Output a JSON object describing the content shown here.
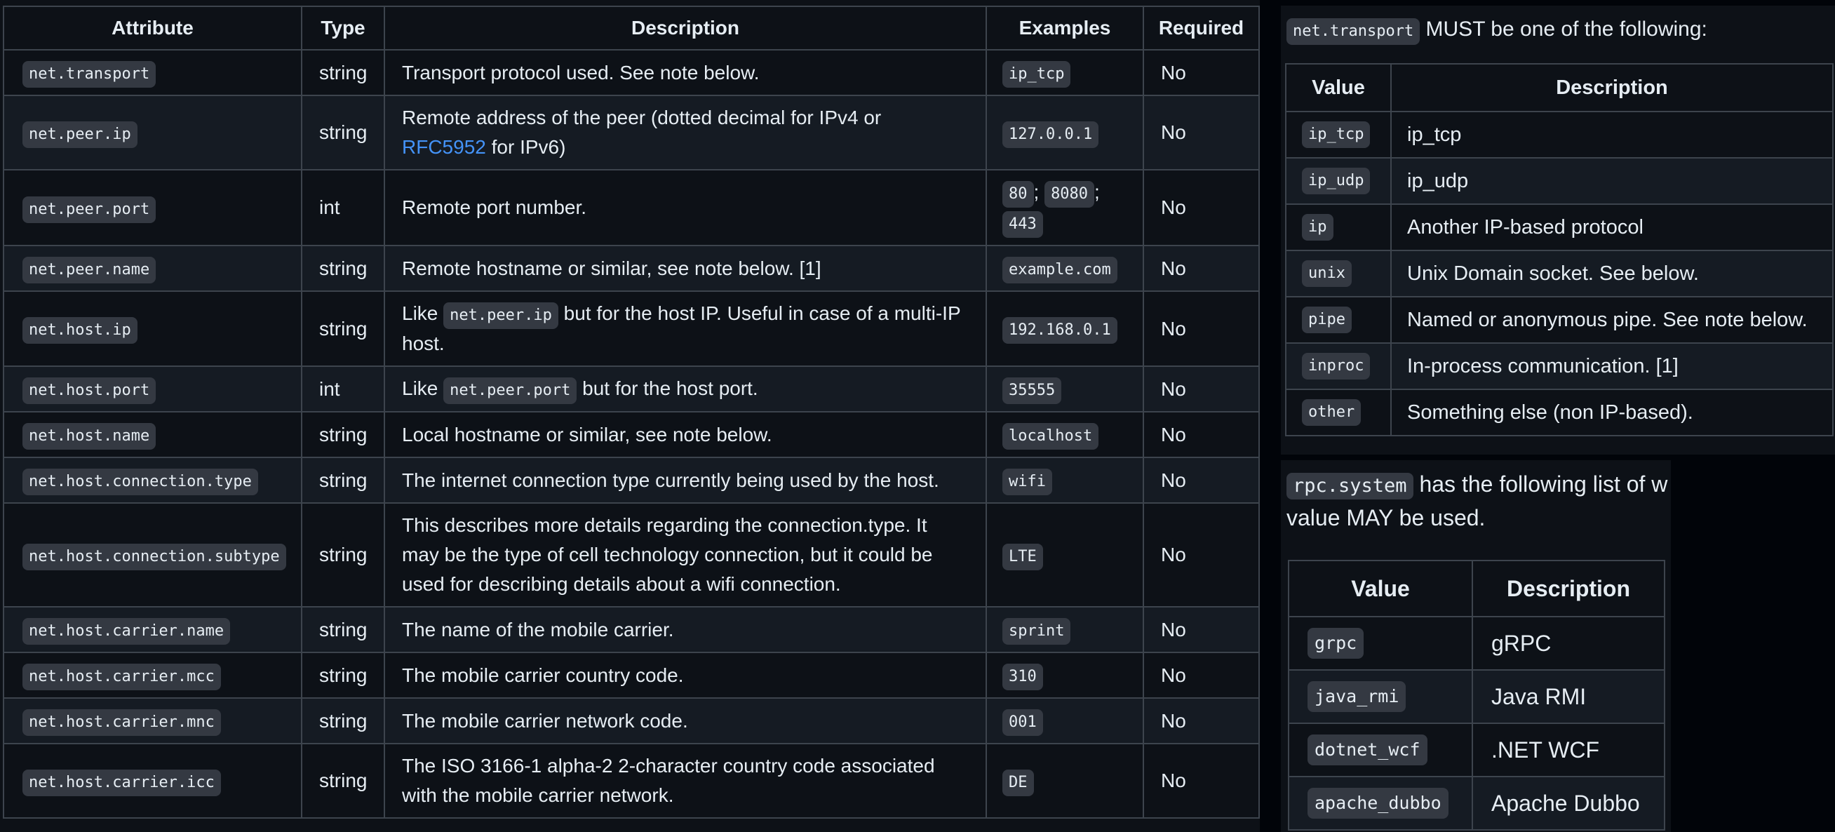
{
  "attributes_table": {
    "headers": {
      "attribute": "Attribute",
      "type": "Type",
      "description": "Description",
      "examples": "Examples",
      "required": "Required"
    },
    "rows": [
      {
        "attribute": "net.transport",
        "type": "string",
        "description": "Transport protocol used. See note below.",
        "examples": [
          "ip_tcp"
        ],
        "required": "No"
      },
      {
        "attribute": "net.peer.ip",
        "type": "string",
        "description_before": "Remote address of the peer (dotted decimal for IPv4 or ",
        "description_link": "RFC5952",
        "description_after": " for IPv6)",
        "examples": [
          "127.0.0.1"
        ],
        "required": "No"
      },
      {
        "attribute": "net.peer.port",
        "type": "int",
        "description": "Remote port number.",
        "examples": [
          "80",
          "8080",
          "443"
        ],
        "examples_separator": ";",
        "required": "No"
      },
      {
        "attribute": "net.peer.name",
        "type": "string",
        "description": "Remote hostname or similar, see note below. [1]",
        "examples": [
          "example.com"
        ],
        "required": "No"
      },
      {
        "attribute": "net.host.ip",
        "type": "string",
        "description_before": "Like ",
        "description_code": "net.peer.ip",
        "description_after": " but for the host IP. Useful in case of a multi-IP host.",
        "examples": [
          "192.168.0.1"
        ],
        "required": "No"
      },
      {
        "attribute": "net.host.port",
        "type": "int",
        "description_before": "Like ",
        "description_code": "net.peer.port",
        "description_after": " but for the host port.",
        "examples": [
          "35555"
        ],
        "required": "No"
      },
      {
        "attribute": "net.host.name",
        "type": "string",
        "description": "Local hostname or similar, see note below.",
        "examples": [
          "localhost"
        ],
        "required": "No"
      },
      {
        "attribute": "net.host.connection.type",
        "type": "string",
        "description": "The internet connection type currently being used by the host.",
        "examples": [
          "wifi"
        ],
        "required": "No"
      },
      {
        "attribute": "net.host.connection.subtype",
        "type": "string",
        "description": "This describes more details regarding the connection.type. It may be the type of cell technology connection, but it could be used for describing details about a wifi connection.",
        "examples": [
          "LTE"
        ],
        "required": "No"
      },
      {
        "attribute": "net.host.carrier.name",
        "type": "string",
        "description": "The name of the mobile carrier.",
        "examples": [
          "sprint"
        ],
        "required": "No"
      },
      {
        "attribute": "net.host.carrier.mcc",
        "type": "string",
        "description": "The mobile carrier country code.",
        "examples": [
          "310"
        ],
        "required": "No"
      },
      {
        "attribute": "net.host.carrier.mnc",
        "type": "string",
        "description": "The mobile carrier network code.",
        "examples": [
          "001"
        ],
        "required": "No"
      },
      {
        "attribute": "net.host.carrier.icc",
        "type": "string",
        "description": "The ISO 3166-1 alpha-2 2-character country code associated with the mobile carrier network.",
        "examples": [
          "DE"
        ],
        "required": "No"
      }
    ]
  },
  "transport_panel": {
    "intro_code": "net.transport",
    "intro_text": " MUST be one of the following:",
    "headers": {
      "value": "Value",
      "description": "Description"
    },
    "rows": [
      {
        "value": "ip_tcp",
        "description": "ip_tcp"
      },
      {
        "value": "ip_udp",
        "description": "ip_udp"
      },
      {
        "value": "ip",
        "description": "Another IP-based protocol"
      },
      {
        "value": "unix",
        "description": "Unix Domain socket. See below."
      },
      {
        "value": "pipe",
        "description": "Named or anonymous pipe. See note below."
      },
      {
        "value": "inproc",
        "description": "In-process communication. [1]"
      },
      {
        "value": "other",
        "description": "Something else (non IP-based)."
      }
    ]
  },
  "rpc_panel": {
    "intro_code": "rpc.system",
    "intro_text_line1": " has the following list of w",
    "intro_text_line2": "value MAY be used.",
    "headers": {
      "value": "Value",
      "description": "Description"
    },
    "rows": [
      {
        "value": "grpc",
        "description": "gRPC"
      },
      {
        "value": "java_rmi",
        "description": "Java RMI"
      },
      {
        "value": "dotnet_wcf",
        "description": ".NET WCF"
      },
      {
        "value": "apache_dubbo",
        "description": "Apache Dubbo"
      }
    ]
  }
}
